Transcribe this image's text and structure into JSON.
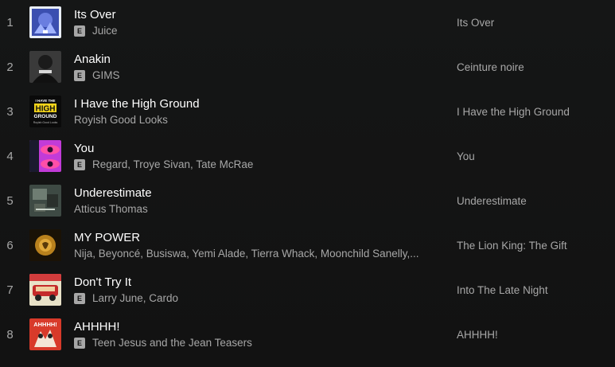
{
  "tracks": [
    {
      "index": "1",
      "title": "Its Over",
      "explicit": true,
      "artists": "Juice",
      "album": "Its Over",
      "cover_icon": "album-cover-its-over"
    },
    {
      "index": "2",
      "title": "Anakin",
      "explicit": true,
      "artists": "GIMS",
      "album": "Ceinture noire",
      "cover_icon": "album-cover-ceinture-noire"
    },
    {
      "index": "3",
      "title": "I Have the High Ground",
      "explicit": false,
      "artists": "Royish Good Looks",
      "album": "I Have the High Ground",
      "cover_icon": "album-cover-high-ground",
      "cover_text": [
        "I HAVE THE",
        "HIGH",
        "GROUND",
        "Royish Good Looks"
      ]
    },
    {
      "index": "4",
      "title": "You",
      "explicit": true,
      "artists": "Regard, Troye Sivan, Tate McRae",
      "album": "You",
      "cover_icon": "album-cover-you"
    },
    {
      "index": "5",
      "title": "Underestimate",
      "explicit": false,
      "artists": "Atticus Thomas",
      "album": "Underestimate",
      "cover_icon": "album-cover-underestimate"
    },
    {
      "index": "6",
      "title": "MY POWER",
      "explicit": false,
      "artists": "Nija, Beyoncé, Busiswa, Yemi Alade, Tierra Whack, Moonchild Sanelly,...",
      "album": "The Lion King: The Gift",
      "cover_icon": "album-cover-lion-king"
    },
    {
      "index": "7",
      "title": "Don't Try It",
      "explicit": true,
      "artists": "Larry June, Cardo",
      "album": "Into The Late Night",
      "cover_icon": "album-cover-late-night"
    },
    {
      "index": "8",
      "title": "AHHHH!",
      "explicit": true,
      "artists": "Teen Jesus and the Jean Teasers",
      "album": "AHHHH!",
      "cover_icon": "album-cover-ahhhh",
      "cover_text": [
        "AHHHH!"
      ]
    }
  ],
  "explicit_label": "E",
  "colors": {
    "background": "#121212",
    "title": "#ffffff",
    "secondary": "#a7a7a7"
  }
}
